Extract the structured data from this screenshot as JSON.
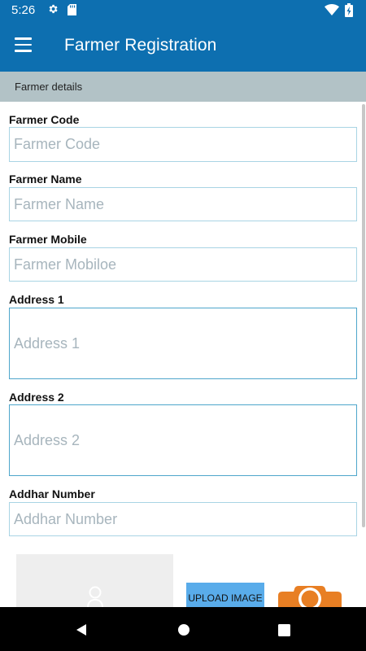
{
  "status_bar": {
    "time": "5:26",
    "icons": [
      "gear-icon",
      "sd-card-icon",
      "wifi-icon",
      "battery-charging-icon"
    ]
  },
  "app_bar": {
    "title": "Farmer Registration",
    "menu_icon": "hamburger-menu-icon"
  },
  "section": {
    "title": "Farmer details"
  },
  "form": {
    "farmer_code": {
      "label": "Farmer Code",
      "placeholder": "Farmer Code",
      "value": ""
    },
    "farmer_name": {
      "label": "Farmer Name",
      "placeholder": "Farmer Name",
      "value": ""
    },
    "farmer_mobile": {
      "label": "Farmer Mobile",
      "placeholder": "Farmer Mobiloe",
      "value": ""
    },
    "address1": {
      "label": "Address 1",
      "placeholder": "Address 1",
      "value": ""
    },
    "address2": {
      "label": "Address 2",
      "placeholder": "Address 2",
      "value": ""
    },
    "addhar_number": {
      "label": "Addhar Number",
      "placeholder": "Addhar Number",
      "value": ""
    }
  },
  "photo": {
    "upload_label": "UPLOAD IMAGE",
    "camera_icon": "camera-icon",
    "placeholder_icon": "person-icon"
  },
  "nav_bar": {
    "icons": [
      "back-icon",
      "home-icon",
      "recents-icon"
    ]
  },
  "colors": {
    "primary": "#0d6fb0",
    "section_bg": "#b2c2c6",
    "input_border": "#a9d4e4",
    "upload_button": "#59acea",
    "camera": "#e87f24"
  }
}
